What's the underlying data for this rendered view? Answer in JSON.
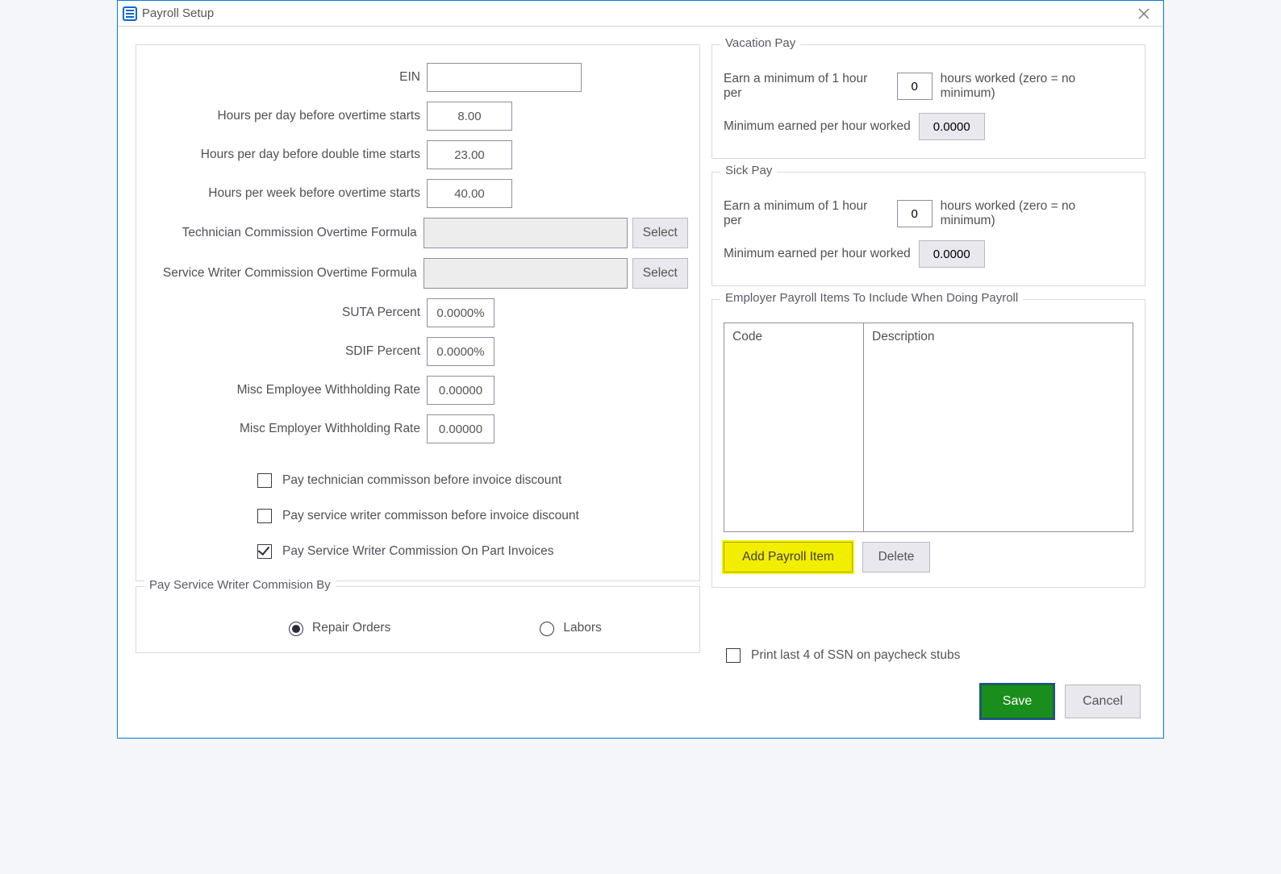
{
  "window": {
    "title": "Payroll Setup"
  },
  "left": {
    "ein_label": "EIN",
    "ein_value": "",
    "hpd_ot_label": "Hours per day before overtime starts",
    "hpd_ot_value": "8.00",
    "hpd_dt_label": "Hours per day before double time starts",
    "hpd_dt_value": "23.00",
    "hpw_ot_label": "Hours per week before overtime starts",
    "hpw_ot_value": "40.00",
    "tech_formula_label": "Technician Commission Overtime Formula",
    "tech_formula_value": "",
    "sw_formula_label": "Service Writer Commission Overtime Formula",
    "sw_formula_value": "",
    "select_label": "Select",
    "suta_label": "SUTA Percent",
    "suta_value": "0.0000%",
    "sdif_label": "SDIF Percent",
    "sdif_value": "0.0000%",
    "misc_emp_wh_label": "Misc Employee Withholding Rate",
    "misc_emp_wh_value": "0.00000",
    "misc_er_wh_label": "Misc Employer Withholding Rate",
    "misc_er_wh_value": "0.00000",
    "chk1": "Pay technician commisson before invoice discount",
    "chk2": "Pay service writer commisson before invoice discount",
    "chk3": "Pay Service Writer Commission On Part Invoices"
  },
  "payby": {
    "legend": "Pay Service Writer Commision By",
    "opt1": "Repair Orders",
    "opt2": "Labors"
  },
  "vacation": {
    "legend": "Vacation Pay",
    "row1_pre": "Earn a minimum of 1 hour per",
    "row1_val": "0",
    "row1_post": "hours worked  (zero = no minimum)",
    "row2_label": "Minimum earned per hour worked",
    "row2_val": "0.0000"
  },
  "sick": {
    "legend": "Sick Pay",
    "row1_pre": "Earn a minimum of 1 hour per",
    "row1_val": "0",
    "row1_post": "hours worked  (zero = no minimum)",
    "row2_label": "Minimum earned per hour worked",
    "row2_val": "0.0000"
  },
  "items": {
    "legend": "Employer Payroll Items To Include When Doing Payroll",
    "th1": "Code",
    "th2": "Description",
    "add": "Add Payroll Item",
    "del": "Delete"
  },
  "ssn_label": "Print last 4 of SSN on paycheck stubs",
  "footer": {
    "save": "Save",
    "cancel": "Cancel"
  }
}
